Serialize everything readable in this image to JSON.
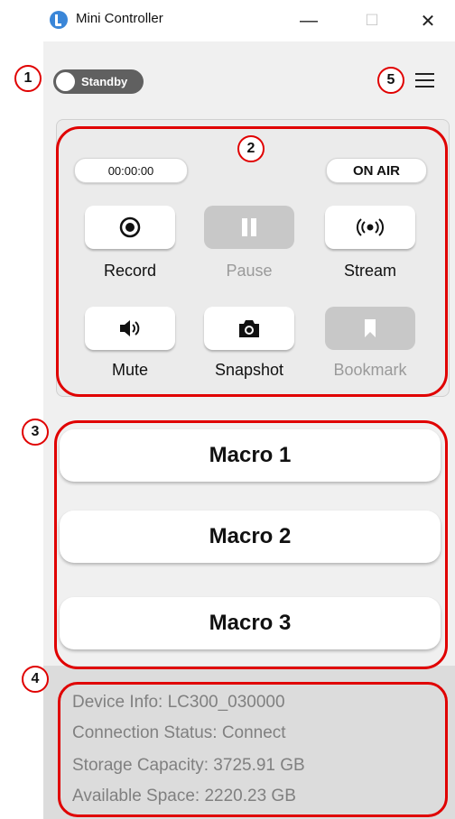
{
  "window": {
    "title": "Mini Controller",
    "minimize": "—",
    "maximize": "☐",
    "close": "✕"
  },
  "toggle": {
    "label": "Standby",
    "state": "off"
  },
  "panel": {
    "timer": "00:00:00",
    "on_air": "ON AIR",
    "buttons": [
      {
        "label": "Record",
        "icon": "record-icon",
        "enabled": true
      },
      {
        "label": "Pause",
        "icon": "pause-icon",
        "enabled": false
      },
      {
        "label": "Stream",
        "icon": "stream-icon",
        "enabled": true
      },
      {
        "label": "Mute",
        "icon": "speaker-icon",
        "enabled": true
      },
      {
        "label": "Snapshot",
        "icon": "camera-icon",
        "enabled": true
      },
      {
        "label": "Bookmark",
        "icon": "bookmark-icon",
        "enabled": false
      }
    ]
  },
  "macros": [
    "Macro 1",
    "Macro 2",
    "Macro 3"
  ],
  "device_info": {
    "device": "Device Info: LC300_030000",
    "connection": "Connection Status: Connect",
    "storage": "Storage Capacity: 3725.91 GB",
    "available": "Available Space: 2220.23 GB"
  },
  "annotations": [
    "1",
    "2",
    "3",
    "4",
    "5"
  ],
  "colors": {
    "annotation_red": "#e00000",
    "toggle_bg": "#606060",
    "disabled_button": "#c8c8c8"
  }
}
